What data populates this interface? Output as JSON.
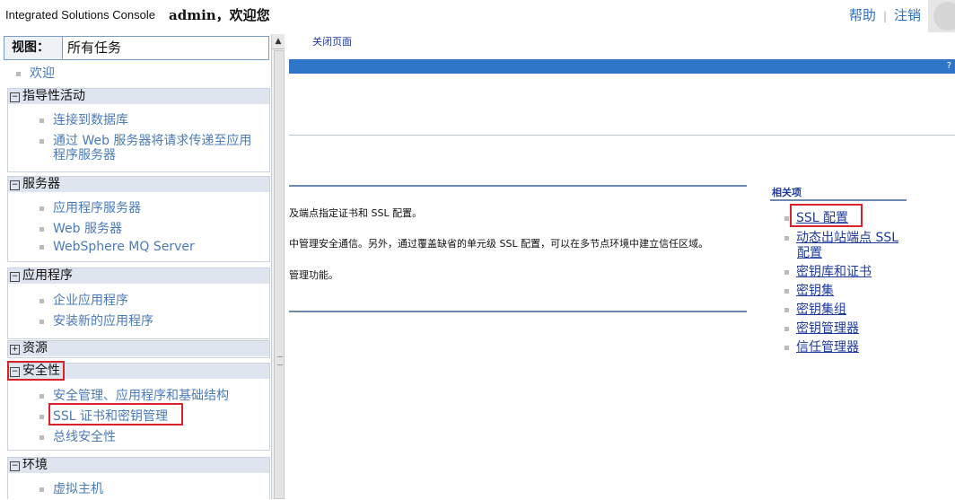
{
  "header": {
    "console_title": "Integrated Solutions Console",
    "welcome": "admin，欢迎您",
    "help": "帮助",
    "logout": "注销"
  },
  "nav": {
    "view_label": "视图：",
    "view_value": "所有任务",
    "welcome_item": "欢迎",
    "groups": [
      {
        "title": "指导性活动",
        "toggle": "⊟",
        "items": [
          "连接到数据库",
          "通过 Web 服务器将请求传递至应用",
          "程序服务器"
        ]
      },
      {
        "title": "服务器",
        "toggle": "⊟",
        "items": [
          "应用程序服务器",
          "Web 服务器",
          "WebSphere MQ Server"
        ]
      },
      {
        "title": "应用程序",
        "toggle": "⊟",
        "items": [
          "企业应用程序",
          "安装新的应用程序"
        ]
      },
      {
        "title": "资源",
        "toggle": "⊞",
        "items": []
      },
      {
        "title": "安全性",
        "toggle": "⊟",
        "items": [
          "安全管理、应用程序和基础结构",
          "SSL 证书和密钥管理",
          "总线安全性"
        ]
      },
      {
        "title": "环境",
        "toggle": "⊟",
        "items": [
          "虚拟主机"
        ]
      }
    ]
  },
  "main": {
    "close_page": "关闭页面",
    "help_icon": "?",
    "desc_lines": [
      "及端点指定证书和 SSL 配置。",
      "中管理安全通信。另外，通过覆盖缺省的单元级 SSL 配置，可以在多节点环境中建立信任区域。",
      "管理功能。"
    ],
    "related": {
      "title": "相关项",
      "links": [
        "SSL 配置",
        "动态出站端点 SSL",
        "配置",
        "密钥库和证书",
        "密钥集",
        "密钥集组",
        "密钥管理器",
        "信任管理器"
      ]
    }
  },
  "colors": {
    "accent_blue": "#2f75c8",
    "highlight_red": "#d8232a",
    "link": "#1d3a9e"
  }
}
